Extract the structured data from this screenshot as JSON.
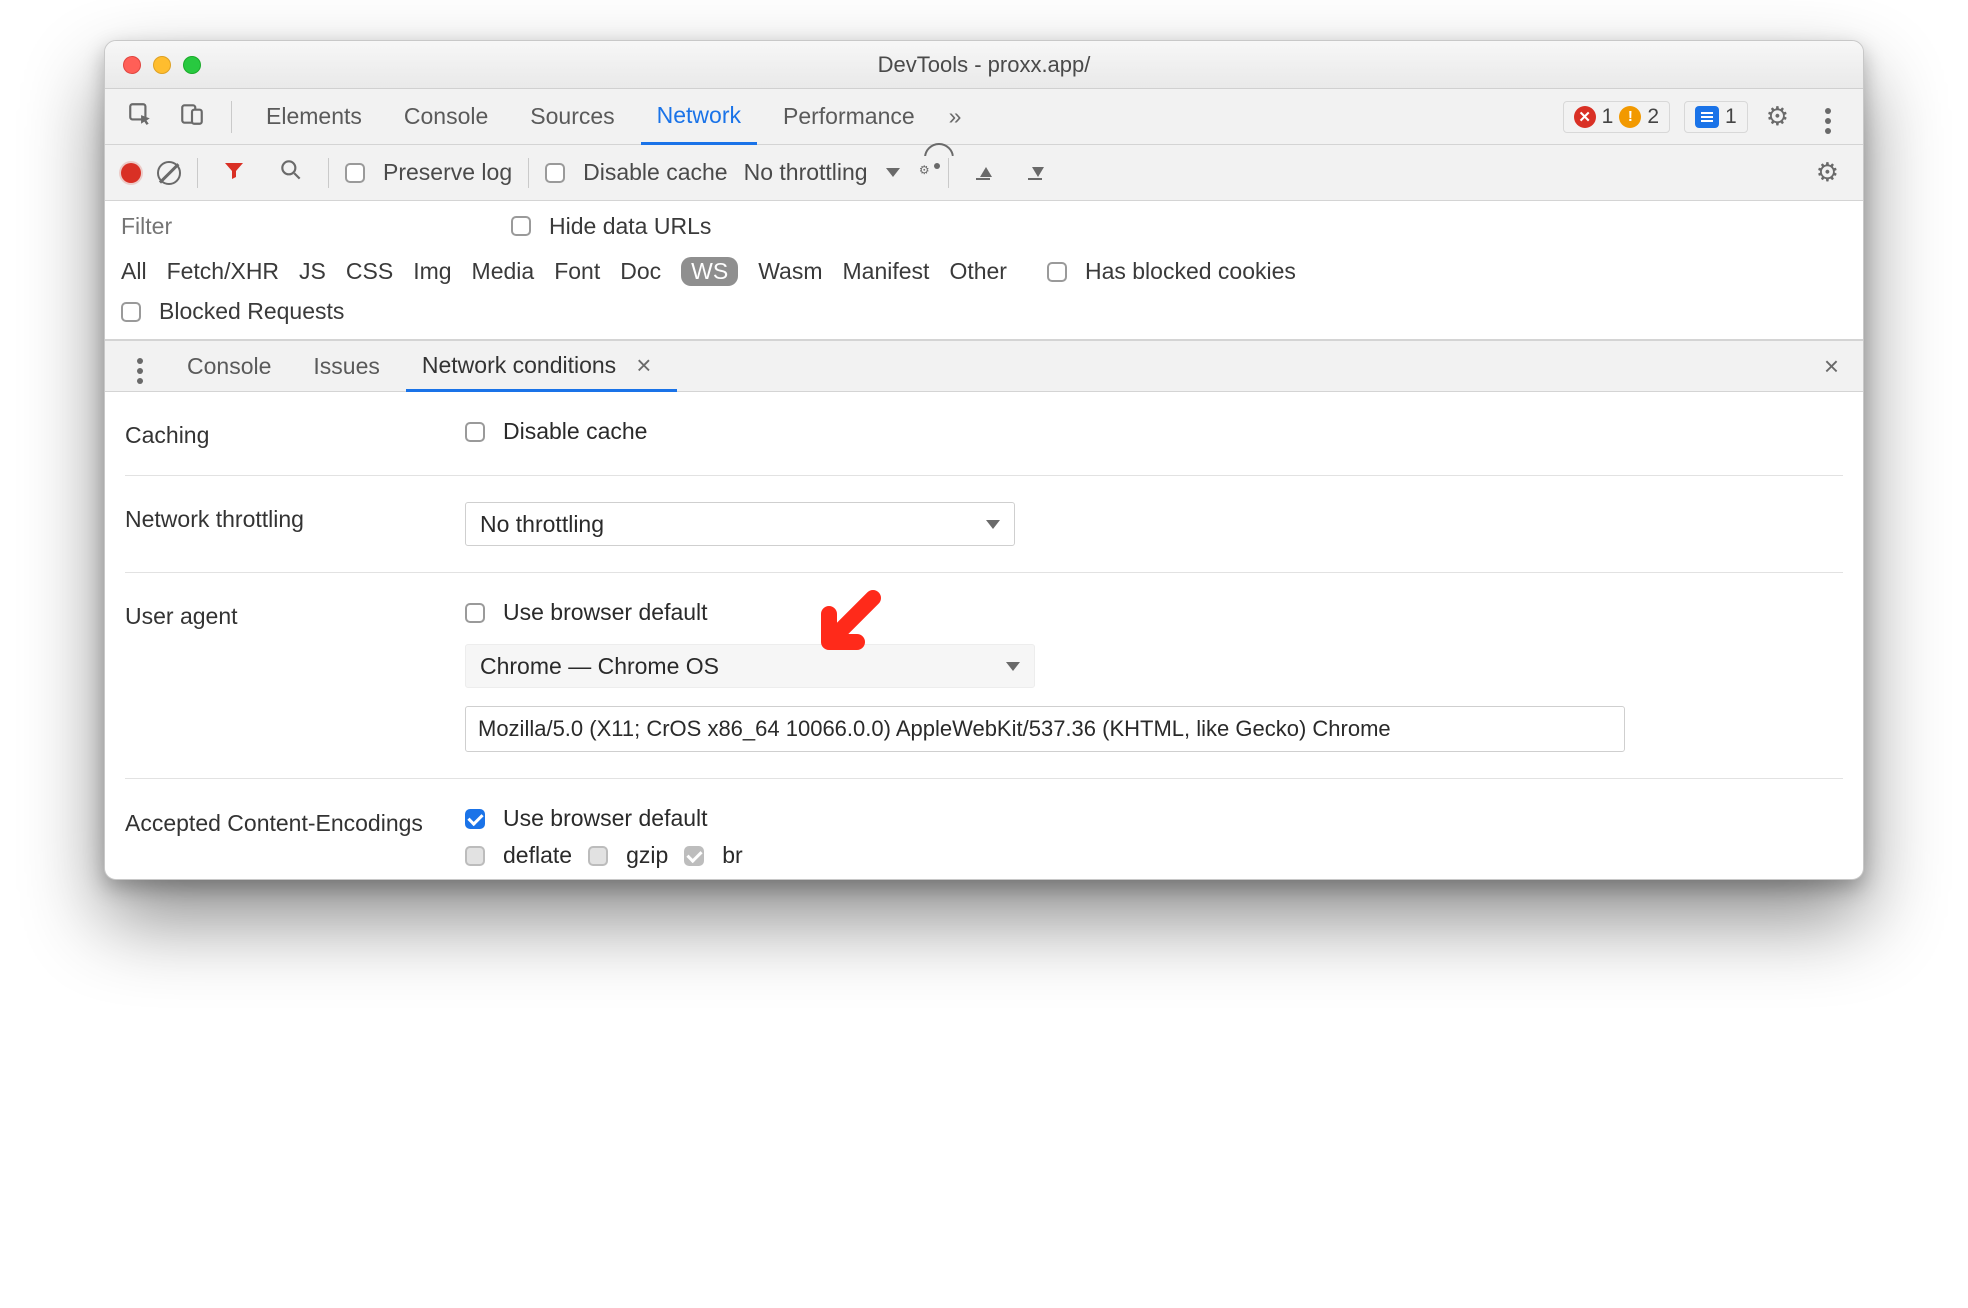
{
  "window": {
    "title": "DevTools - proxx.app/"
  },
  "tabs": {
    "items": [
      "Elements",
      "Console",
      "Sources",
      "Network",
      "Performance"
    ],
    "active": "Network",
    "more_glyph": "»"
  },
  "badges": {
    "errors": "1",
    "warnings": "2",
    "messages": "1"
  },
  "net_toolbar": {
    "preserve_log": "Preserve log",
    "disable_cache": "Disable cache",
    "throttling": "No throttling"
  },
  "filter": {
    "placeholder": "Filter",
    "hide_data_urls": "Hide data URLs",
    "types": [
      "All",
      "Fetch/XHR",
      "JS",
      "CSS",
      "Img",
      "Media",
      "Font",
      "Doc",
      "WS",
      "Wasm",
      "Manifest",
      "Other"
    ],
    "selected_type": "WS",
    "has_blocked_cookies": "Has blocked cookies",
    "blocked_requests": "Blocked Requests"
  },
  "drawer": {
    "tabs": [
      "Console",
      "Issues",
      "Network conditions"
    ],
    "active": "Network conditions"
  },
  "conditions": {
    "caching_label": "Caching",
    "caching_disable": "Disable cache",
    "throttling_label": "Network throttling",
    "throttling_value": "No throttling",
    "ua_label": "User agent",
    "ua_use_default": "Use browser default",
    "ua_select": "Chrome — Chrome OS",
    "ua_string": "Mozilla/5.0 (X11; CrOS x86_64 10066.0.0) AppleWebKit/537.36 (KHTML, like Gecko) Chrome",
    "enc_label": "Accepted Content-Encodings",
    "enc_use_default": "Use browser default",
    "enc_deflate": "deflate",
    "enc_gzip": "gzip",
    "enc_br": "br"
  }
}
